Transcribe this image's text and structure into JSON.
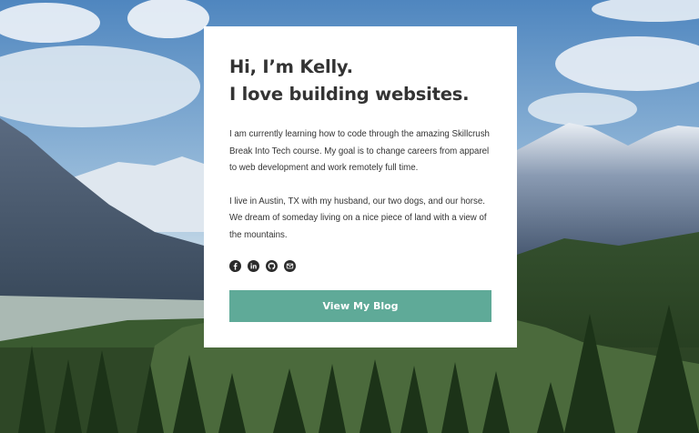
{
  "hero": {
    "headline_line1": "Hi, I’m Kelly.",
    "headline_line2": "I love building websites.",
    "paragraph1": "I am currently learning how to code through the amazing Skillcrush Break Into Tech course. My goal is to change careers from apparel to web development and work remotely full time.",
    "paragraph2": "I live in Austin, TX with my husband, our two dogs, and our horse. We dream of someday living on a nice piece of land with a view of the mountains.",
    "social_icons": [
      "facebook-icon",
      "linkedin-icon",
      "github-icon",
      "email-icon"
    ],
    "button_label": "View My Blog"
  },
  "colors": {
    "accent": "#5faa98",
    "text": "#333333",
    "card": "#ffffff"
  }
}
